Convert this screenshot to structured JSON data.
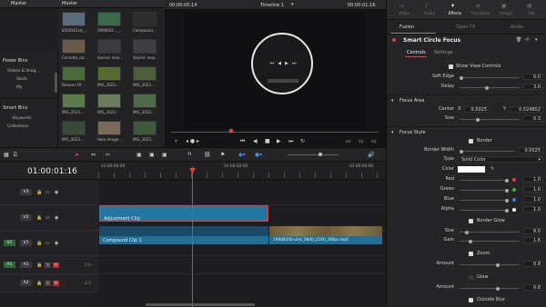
{
  "bins": {
    "header": "Master",
    "power_bins_title": "Power Bins",
    "power_bins_items": [
      "Videos & Imag...",
      "Stock",
      "My"
    ],
    "smart_bins_title": "Smart Bins",
    "smart_bins_items": [
      "Keywords",
      "Collections"
    ]
  },
  "pool": {
    "header": "Master",
    "clips": [
      {
        "label": "8509161sd_...",
        "color": "#5a6a7a"
      },
      {
        "label": "1990834..._...",
        "color": "#3a6a4a"
      },
      {
        "label": "Compound...",
        "color": "#2e2e2e"
      },
      {
        "label": "Corvette_oa...",
        "color": "#6a5a4a"
      },
      {
        "label": "davinci reso...",
        "color": "#3a3a40"
      },
      {
        "label": "davinci reso...",
        "color": "#3e3e44"
      },
      {
        "label": "Dreams Of ...",
        "color": "#4a6a3a"
      },
      {
        "label": "IMG_2023...",
        "color": "#556b2f"
      },
      {
        "label": "IMG_2023...",
        "color": "#4a5e3a"
      },
      {
        "label": "IMG_2023...",
        "color": "#5c7a4a"
      },
      {
        "label": "IMG_2023...",
        "color": "#6a7c5a"
      },
      {
        "label": "IMG_2023...",
        "color": "#4e6a48"
      },
      {
        "label": "IMG_2023...",
        "color": "#3a4a38"
      },
      {
        "label": "Hero Image...",
        "color": "#7a6a5a"
      },
      {
        "label": "IMG_2023...",
        "color": "#3e5a3a"
      }
    ]
  },
  "viewer": {
    "timecode_left": "00:00:05:14",
    "timeline_name": "Timeline 1",
    "timecode_right": "00:00:01:16"
  },
  "inspector": {
    "tabs": [
      "Video",
      "Audio",
      "Effects",
      "Transition",
      "Image",
      "File"
    ],
    "active_tab": "Effects",
    "subtabs": [
      "Fusion",
      "Open FX",
      "Audio"
    ],
    "effect_name": "Smart Circle Focus",
    "section_tabs": [
      "Controls",
      "Settings"
    ],
    "show_view_controls": "Show View Controls",
    "soft_edge_label": "Soft Edge",
    "soft_edge": "0.0",
    "delay_label": "Delay",
    "delay": "3.0",
    "focus_area_title": "Focus Area",
    "center_label": "Center",
    "x_label": "X",
    "center_x": "0.5025",
    "y_label": "Y",
    "center_y": "0.524802",
    "size_label": "Size",
    "size": "0.3",
    "focus_style_title": "Focus Style",
    "border_label": "Border",
    "border_width_label": "Border Width",
    "border_width": "0.0025",
    "type_label": "Type",
    "type_value": "Solid Color",
    "color_label": "Color",
    "red_label": "Red",
    "red": "1.0",
    "green_label": "Green",
    "green": "1.0",
    "blue_label": "Blue",
    "blue": "1.0",
    "alpha_label": "Alpha",
    "alpha": "1.0",
    "border_glow_label": "Border Glow",
    "glow_size_label": "Size",
    "glow_size": "8.0",
    "gain_label": "Gain",
    "gain": "1.6",
    "zoom_label": "Zoom",
    "zoom_amount_label": "Amount",
    "zoom_amount": "0.8",
    "glow_label": "Glow",
    "glow_amount_label": "Amount",
    "glow_amount": "0.8",
    "outside_blur_label": "Outside Blur"
  },
  "timeline": {
    "timecode": "01:00:01:16",
    "ruler": [
      "01:00:00:00",
      "01:00:02:00",
      "01:00:04:00"
    ],
    "tracks": [
      {
        "id": "V3",
        "badge_color": "#b03030"
      },
      {
        "id": "V2",
        "badge_color": "#b03030"
      },
      {
        "id": "V1",
        "badge_color": "#b03030"
      },
      {
        "id": "A1",
        "badge_color": "#b03030"
      },
      {
        "id": "A2",
        "badge_color": "#b03030"
      }
    ],
    "v1_chip": "V1",
    "a1_chip": "A1",
    "audio_level": "2.0",
    "adjustment_clip": "Adjustment Clip",
    "compound_clip": "Compound Clip 1",
    "video_clip": "1990834S-uhd_3840_2160_30fps.mp4"
  },
  "colors": {
    "accent_red": "#e04040",
    "clip_blue": "#1f6f96",
    "playhead": "#e03c3c"
  }
}
